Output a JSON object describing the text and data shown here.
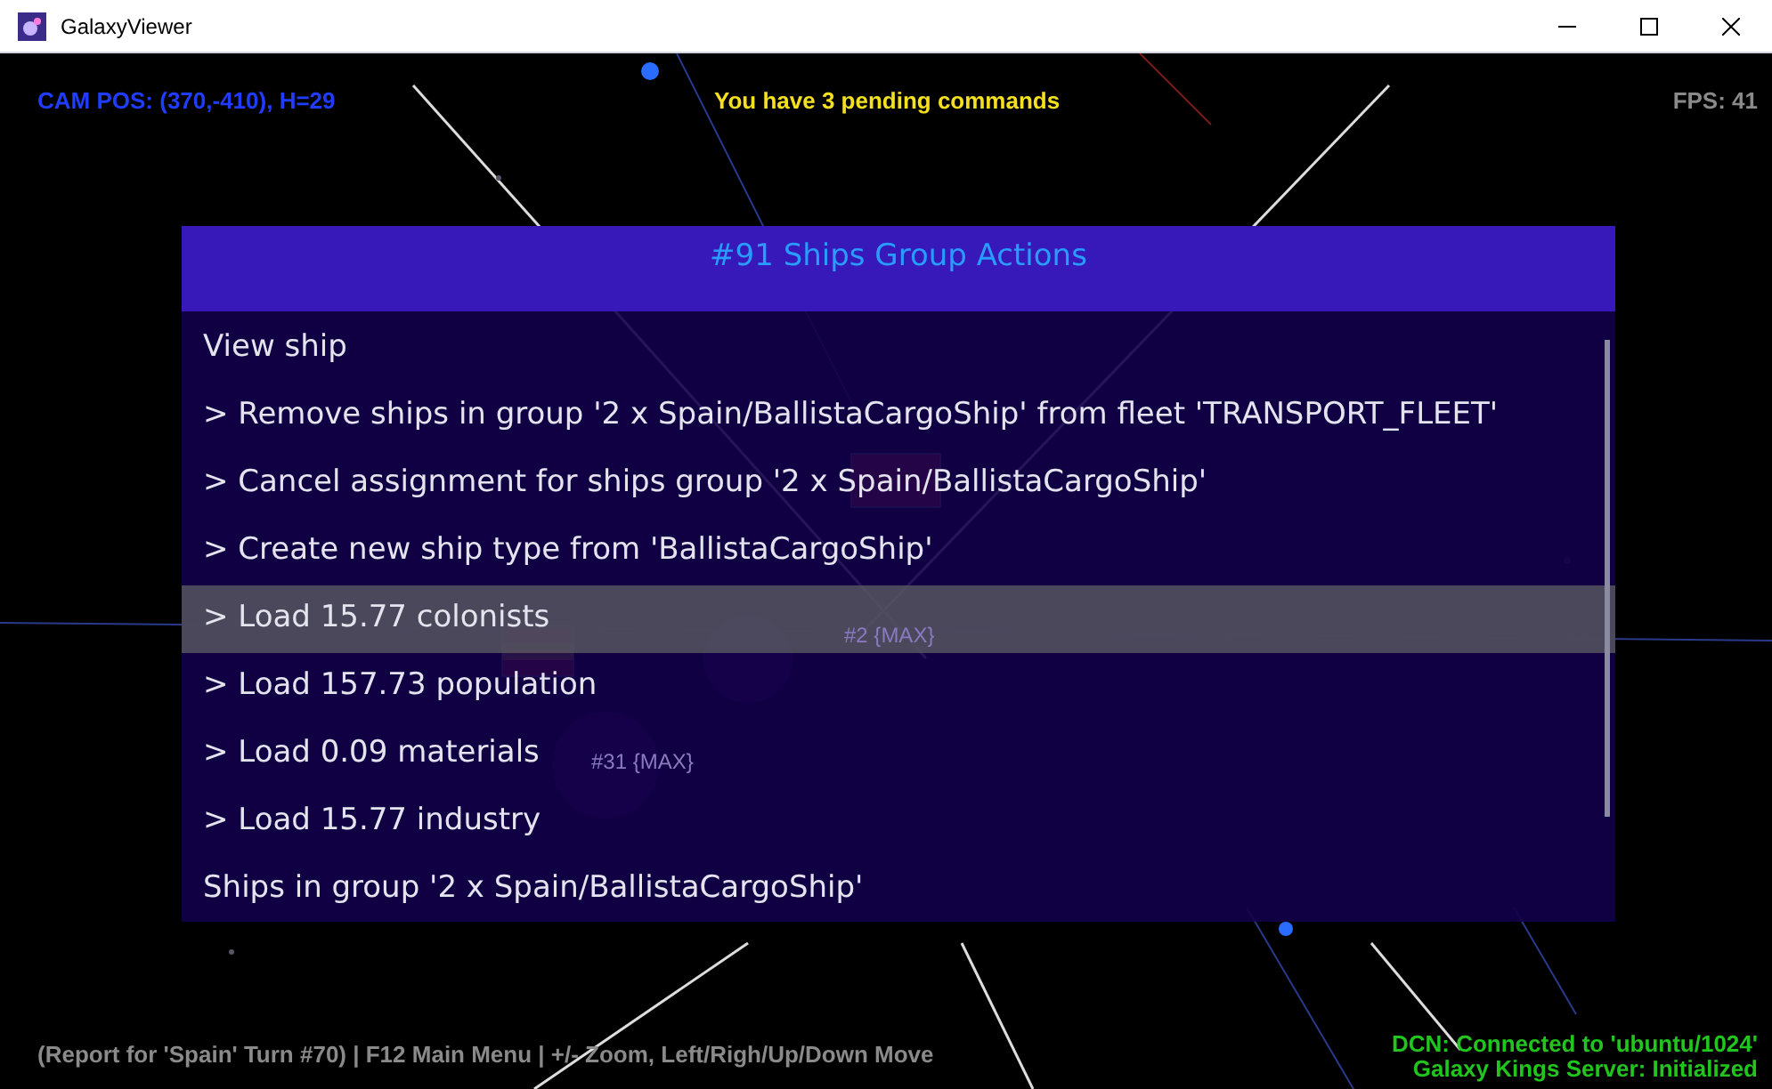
{
  "window": {
    "title": "GalaxyViewer"
  },
  "hud": {
    "camera": "CAM POS: (370,-410), H=29",
    "notice": "You have 3 pending commands",
    "fps": "FPS: 41",
    "status": "(Report for 'Spain' Turn #70) | F12 Main Menu | +/- Zoom, Left/Righ/Up/Down Move",
    "connection": [
      "DCN: Connected to 'ubuntu/1024'",
      "Galaxy Kings Server: Initialized"
    ]
  },
  "map_labels": [
    {
      "text": "#2 {MAX}"
    },
    {
      "text": "#31 {MAX}"
    }
  ],
  "dialog": {
    "title": "#91 Ships Group Actions",
    "items": [
      {
        "label": "View ship",
        "selected": false
      },
      {
        "label": "> Remove ships in group '2 x Spain/BallistaCargoShip' from fleet 'TRANSPORT_FLEET'",
        "selected": false
      },
      {
        "label": "> Cancel assignment for ships group '2 x Spain/BallistaCargoShip'",
        "selected": false
      },
      {
        "label": "> Create new ship type from 'BallistaCargoShip'",
        "selected": false
      },
      {
        "label": "> Load 15.77 colonists",
        "selected": true
      },
      {
        "label": "> Load 157.73 population",
        "selected": false
      },
      {
        "label": "> Load 0.09 materials",
        "selected": false
      },
      {
        "label": "> Load 15.77 industry",
        "selected": false
      },
      {
        "label": "Ships in group '2 x Spain/BallistaCargoShip'",
        "selected": false
      }
    ]
  }
}
